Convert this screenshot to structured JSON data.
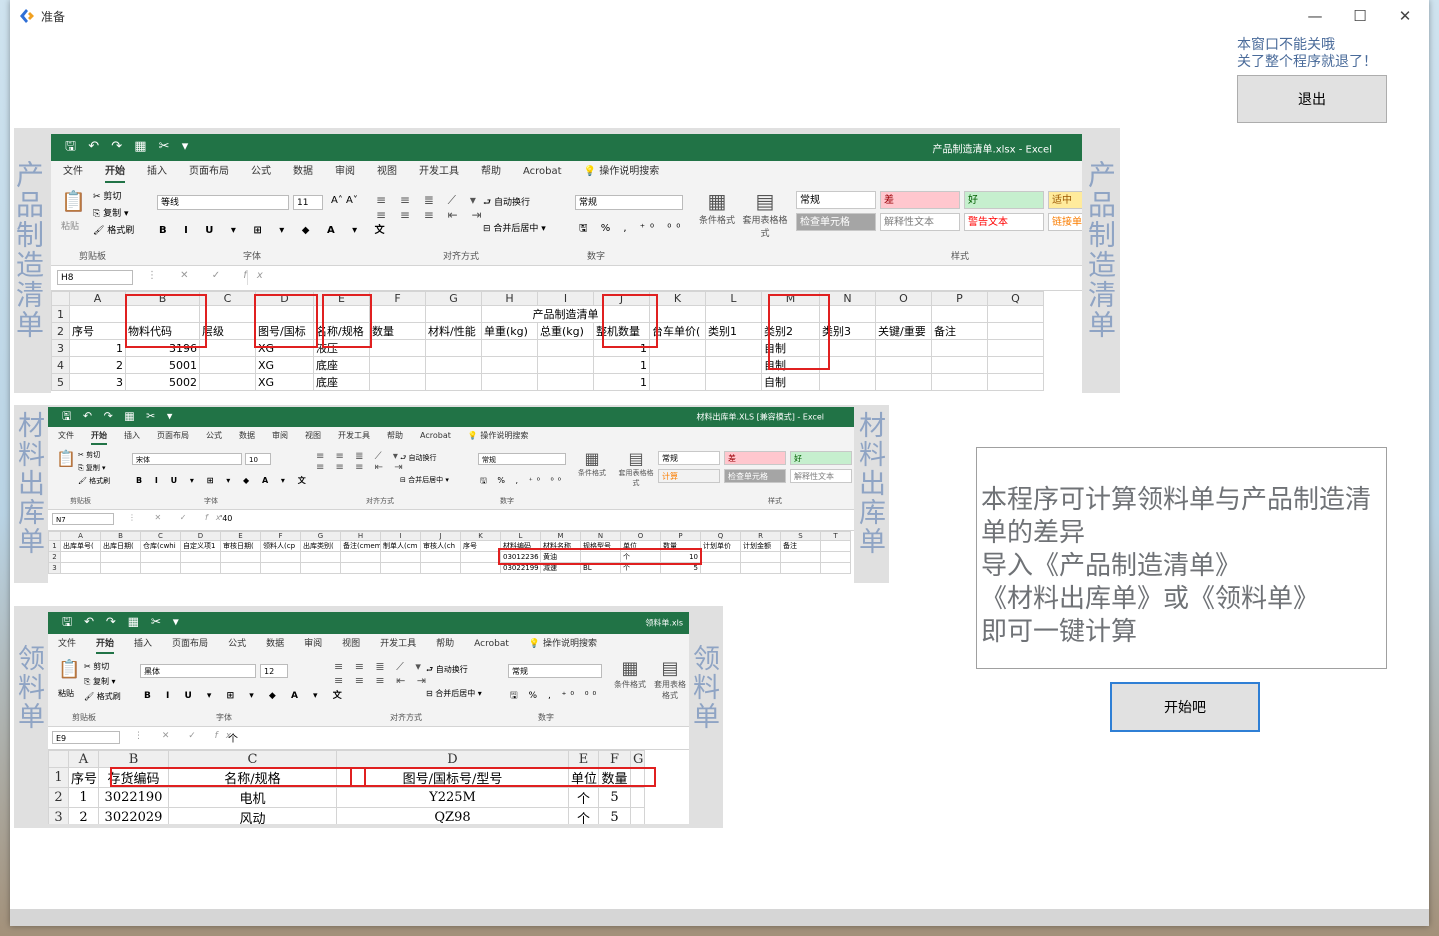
{
  "window": {
    "title": "准备",
    "controls": {
      "minimize": "—",
      "maximize": "☐",
      "close": "✕"
    }
  },
  "notice": {
    "line1": "本窗口不能关哦",
    "line2": "关了整个程序就退了！"
  },
  "buttons": {
    "exit": "退出",
    "start": "开始吧"
  },
  "description": {
    "lines": [
      "本程序可计算领料单与产品制造清单的差异",
      "导入《产品制造清单》",
      "《材料出库单》或《领料单》",
      "即可一键计算"
    ]
  },
  "labels": {
    "product": "产品制造清单",
    "material": "材料出库单",
    "picking": "领料单"
  },
  "excel": {
    "tabs": [
      "文件",
      "开始",
      "插入",
      "页面布局",
      "公式",
      "数据",
      "审阅",
      "视图",
      "开发工具",
      "帮助",
      "Acrobat",
      "操作说明搜索"
    ],
    "groups": [
      "剪贴板",
      "字体",
      "对齐方式",
      "数字",
      "样式"
    ],
    "clip": {
      "paste": "粘贴",
      "cut": "剪切",
      "copy": "复制",
      "painter": "格式刷"
    },
    "align": {
      "wrap": "自动换行",
      "merge": "合并后居中"
    },
    "styles_btn": {
      "cond": "条件格式",
      "table": "套用表格格式"
    },
    "fx": "fx"
  },
  "shot1": {
    "file": "产品制造清单.xlsx - Excel",
    "font": "等线",
    "size": "11",
    "numfmt": "常规",
    "cellref": "H8",
    "styles": [
      {
        "label": "常规",
        "bg": "#ffffff",
        "fg": "#000000"
      },
      {
        "label": "差",
        "bg": "#ffc7ce",
        "fg": "#9c0006"
      },
      {
        "label": "好",
        "bg": "#c6efce",
        "fg": "#006100"
      },
      {
        "label": "适中",
        "bg": "#ffeb9c",
        "fg": "#9c5700"
      },
      {
        "label": "检查单元格",
        "bg": "#a5a5a5",
        "fg": "#ffffff"
      },
      {
        "label": "解释性文本",
        "bg": "#ffffff",
        "fg": "#7f7f7f"
      },
      {
        "label": "警告文本",
        "bg": "#ffffff",
        "fg": "#ff0000"
      },
      {
        "label": "链接单",
        "bg": "#ffffff",
        "fg": "#fa7d00"
      }
    ],
    "cols": [
      "A",
      "B",
      "C",
      "D",
      "E",
      "F",
      "G",
      "H",
      "I",
      "J",
      "K",
      "L",
      "M",
      "N",
      "O",
      "P",
      "Q"
    ],
    "merged_title": "产品制造清单",
    "header": [
      "序号",
      "物料代码",
      "层级",
      "图号/国标",
      "名称/规格",
      "数量",
      "材料/性能",
      "单重(kg)",
      "总重(kg)",
      "整机数量",
      "台车单价(",
      "类别1",
      "类别2",
      "类别3",
      "关键/重要",
      "备注",
      ""
    ],
    "rows": [
      [
        "1",
        "3196",
        "",
        "XG",
        "液压",
        "",
        "",
        "",
        "",
        "1",
        "",
        "",
        "自制",
        "",
        "",
        "",
        ""
      ],
      [
        "2",
        "5001",
        "",
        "XG",
        "底座",
        "",
        "",
        "",
        "",
        "1",
        "",
        "",
        "自制",
        "",
        "",
        "",
        ""
      ],
      [
        "3",
        "5002",
        "",
        "XG",
        "底座",
        "",
        "",
        "",
        "",
        "1",
        "",
        "",
        "自制",
        "",
        "",
        "",
        ""
      ]
    ]
  },
  "shot2": {
    "file": "材料出库单.XLS [兼容模式] - Excel",
    "font": "宋体",
    "size": "10",
    "numfmt": "常规",
    "cellref": "N7",
    "formula": "'40",
    "styles": [
      {
        "label": "常规",
        "bg": "#ffffff",
        "fg": "#000000"
      },
      {
        "label": "差",
        "bg": "#ffc7ce",
        "fg": "#9c0006"
      },
      {
        "label": "好",
        "bg": "#c6efce",
        "fg": "#006100"
      },
      {
        "label": "计算",
        "bg": "#f2f2f2",
        "fg": "#fa7d00"
      },
      {
        "label": "检查单元格",
        "bg": "#a5a5a5",
        "fg": "#ffffff"
      },
      {
        "label": "解释性文本",
        "bg": "#ffffff",
        "fg": "#7f7f7f"
      }
    ],
    "cols": [
      "A",
      "B",
      "C",
      "D",
      "E",
      "F",
      "G",
      "H",
      "I",
      "J",
      "K",
      "L",
      "M",
      "N",
      "O",
      "P",
      "Q",
      "R",
      "S",
      "T"
    ],
    "header": [
      "出库单号(",
      "出库日期(",
      "仓库(cwhi",
      "自定义项1",
      "审核日期(",
      "领料人(cp",
      "出库类别(",
      "备注(cmem",
      "制单人(cm",
      "审核人(ch",
      "序号",
      "材料编码",
      "材料名称",
      "规格型号",
      "单位",
      "数量",
      "计划单价",
      "计划金额",
      "备注",
      ""
    ],
    "rows": [
      [
        "",
        "",
        "",
        "",
        "",
        "",
        "",
        "",
        "",
        "",
        "",
        "03012236",
        "黄油",
        "",
        "个",
        "10",
        "",
        "",
        "",
        ""
      ],
      [
        "",
        "",
        "",
        "",
        "",
        "",
        "",
        "",
        "",
        "",
        "",
        "03022199",
        "减速",
        "BL",
        "个",
        "5",
        "",
        "",
        "",
        ""
      ]
    ]
  },
  "shot3": {
    "file": "领料单.xls",
    "font": "黑体",
    "size": "12",
    "numfmt": "常规",
    "cellref": "E9",
    "formula": "个",
    "cols": [
      "A",
      "B",
      "C",
      "D",
      "E",
      "F",
      "G"
    ],
    "header": [
      "序号",
      "存货编码",
      "名称/规格",
      "图号/国标号/型号",
      "单位",
      "数量",
      ""
    ],
    "rows": [
      [
        "1",
        "3022190",
        "电机",
        "Y225M",
        "个",
        "5",
        ""
      ],
      [
        "2",
        "3022029",
        "风动",
        "QZ98",
        "个",
        "5",
        ""
      ]
    ]
  }
}
